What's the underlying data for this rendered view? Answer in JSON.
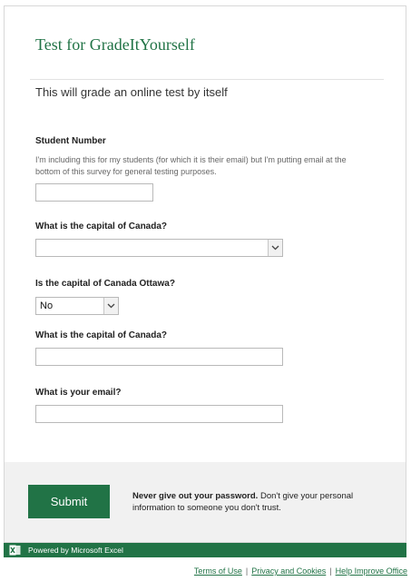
{
  "form": {
    "title": "Test for GradeItYourself",
    "description": "This will grade an online test by itself"
  },
  "questions": [
    {
      "label": "Student Number",
      "help": "I'm including this for my students (for which it is their email) but I'm putting email at the bottom of this survey for general testing purposes.",
      "type": "text",
      "value": ""
    },
    {
      "label": "What is the capital of Canada?",
      "type": "select",
      "selected": ""
    },
    {
      "label": "Is the capital of Canada Ottawa?",
      "type": "select",
      "selected": "No"
    },
    {
      "label": "What is the capital of Canada?",
      "type": "text",
      "value": ""
    },
    {
      "label": "What is your email?",
      "type": "text",
      "value": ""
    }
  ],
  "footer": {
    "submit_label": "Submit",
    "warning_bold": "Never give out your password.",
    "warning_text": " Don't give your personal information to someone you don't trust.",
    "powered_by": "Powered by Microsoft Excel",
    "links": [
      "Terms of Use",
      "Privacy and Cookies",
      "Help Improve Office"
    ]
  },
  "colors": {
    "accent": "#217346",
    "band": "#f1f1f1"
  },
  "icons": {
    "select_arrow": "chevron-down-icon",
    "brand": "excel-icon"
  }
}
